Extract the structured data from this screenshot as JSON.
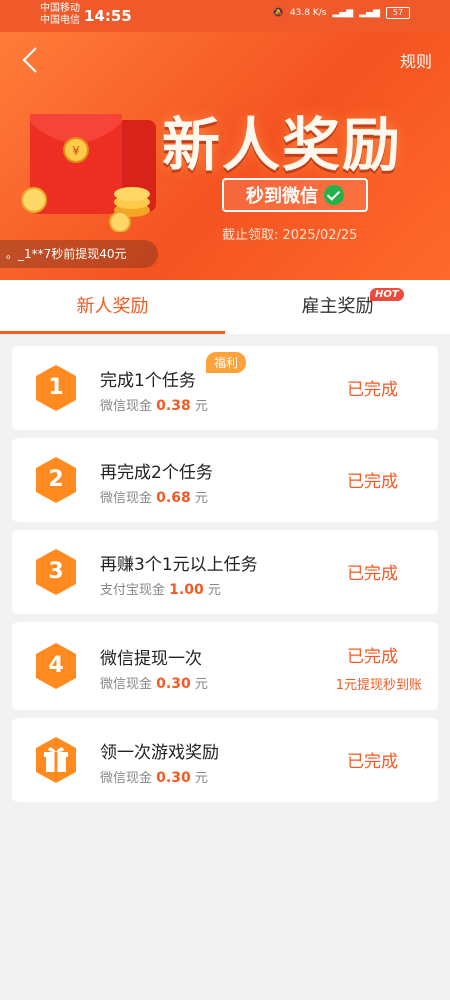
{
  "status_bar": {
    "carrier1": "中国移动",
    "carrier2": "中国电信",
    "time": "14:55",
    "speed": "43.8 K/s",
    "battery": "57"
  },
  "header": {
    "back_icon": "chevron-left-icon",
    "rules": "规则",
    "hero_title": "新人奖励",
    "badge_text": "秒到微信",
    "deadline": "截止领取: 2025/02/25",
    "notice": "。_1**7秒前提现40元"
  },
  "tabs": [
    {
      "label": "新人奖励",
      "active": true
    },
    {
      "label": "雇主奖励",
      "badge": "HOT"
    }
  ],
  "tasks": [
    {
      "step": "1",
      "title": "完成1个任务",
      "badge": "福利",
      "reward_label": "微信现金",
      "amount": "0.38",
      "unit": "元",
      "status": "已完成"
    },
    {
      "step": "2",
      "title": "再完成2个任务",
      "reward_label": "微信现金",
      "amount": "0.68",
      "unit": "元",
      "status": "已完成"
    },
    {
      "step": "3",
      "title": "再赚3个1元以上任务",
      "reward_label": "支付宝现金",
      "amount": "1.00",
      "unit": "元",
      "status": "已完成"
    },
    {
      "step": "4",
      "title": "微信提现一次",
      "reward_label": "微信现金",
      "amount": "0.30",
      "unit": "元",
      "status": "已完成",
      "note": "1元提现秒到账"
    },
    {
      "step_icon": "gift-icon",
      "title": "领一次游戏奖励",
      "reward_label": "微信现金",
      "amount": "0.30",
      "unit": "元",
      "status": "已完成"
    }
  ],
  "colors": {
    "accent": "#f45a22",
    "hex_badge": "#ff8a1f"
  }
}
